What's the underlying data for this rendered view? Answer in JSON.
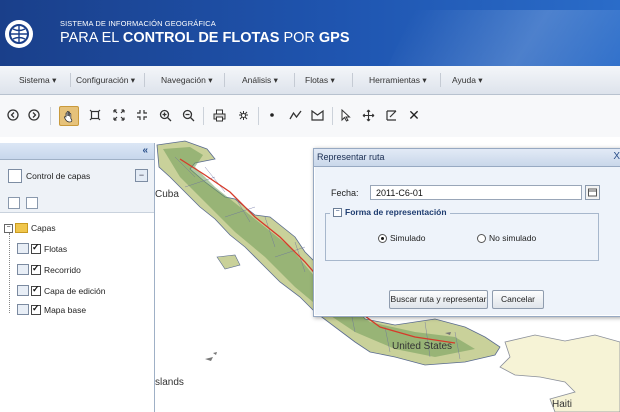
{
  "header": {
    "subtitle": "SISTEMA DE INFORMACIÓN GEOGRÁFICA",
    "title_prefix": "PARA EL ",
    "title_bold": "CONTROL DE FLOTAS",
    "title_mid": " POR ",
    "title_end": "GPS"
  },
  "menu": {
    "items": [
      "Sistema ▾",
      "Configuración ▾",
      "Navegación ▾",
      "Análisis ▾",
      "Flotas ▾",
      "Herramientas ▾",
      "Ayuda ▾"
    ]
  },
  "toolbar": {
    "tools": [
      "zoom-in-nav-icon",
      "zoom-next-icon",
      "pan-hand-icon",
      "zoom-box-icon",
      "full-extent-icon",
      "fit-extent-icon",
      "zoom-in-icon",
      "zoom-out-icon",
      "print-icon",
      "measure-icon",
      "draw-point-icon",
      "draw-line-icon",
      "draw-polygon-icon",
      "select-arrow-icon",
      "move-icon",
      "edit-geometry-icon",
      "delete-icon"
    ],
    "delete_glyph": "✕"
  },
  "panel": {
    "collapse_glyph": "«",
    "layer_control_title": "Control de capas",
    "minimize_glyph": "−",
    "tree_root": "Capas",
    "layers": [
      "Flotas",
      "Recorrido",
      "Capa de edición",
      "Mapa base"
    ]
  },
  "map": {
    "labels": [
      "Cuba",
      "United States",
      "slands",
      "Haiti"
    ],
    "colors": {
      "land": "#c9d19a",
      "relief": "#6f9c5a",
      "route": "#d63a2a",
      "other_land": "#f6f3d6"
    }
  },
  "dialog": {
    "title": "Representar ruta",
    "close_glyph": "X",
    "fecha_label": "Fecha:",
    "fecha_value": "2011-C6-01",
    "section_toggle": "−",
    "section_title": "Forma de representación",
    "radio_simulado": "Simulado",
    "radio_no_simulado": "No simulado",
    "btn_buscar": "Buscar ruta y representar",
    "btn_cancelar": "Cancelar"
  }
}
